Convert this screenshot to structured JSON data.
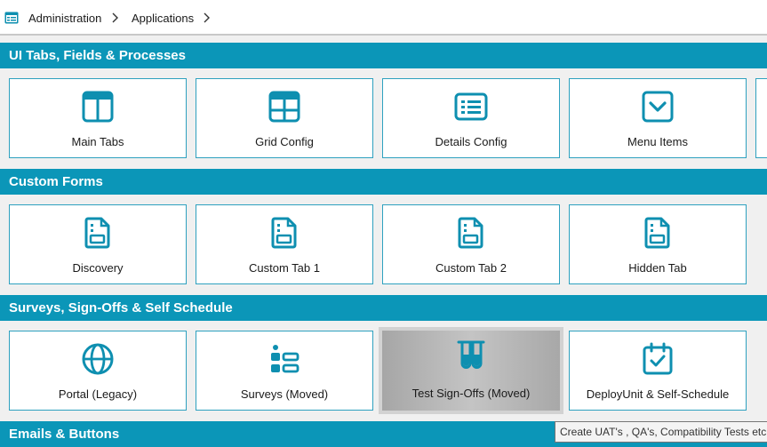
{
  "breadcrumb": {
    "items": [
      "Administration",
      "Applications"
    ]
  },
  "colors": {
    "accent": "#0b96b8",
    "icon": "#0e8fb0",
    "tile_border": "#2ea1bf"
  },
  "sections": [
    {
      "title": "UI Tabs, Fields & Processes",
      "tiles": [
        {
          "label": "Main Tabs",
          "icon": "columns-icon"
        },
        {
          "label": "Grid Config",
          "icon": "grid-icon"
        },
        {
          "label": "Details Config",
          "icon": "list-icon"
        },
        {
          "label": "Menu Items",
          "icon": "dropdown-icon"
        }
      ]
    },
    {
      "title": "Custom Forms",
      "tiles": [
        {
          "label": "Discovery",
          "icon": "form-document-icon"
        },
        {
          "label": "Custom Tab 1",
          "icon": "form-document-icon"
        },
        {
          "label": "Custom Tab 2",
          "icon": "form-document-icon"
        },
        {
          "label": "Hidden Tab",
          "icon": "form-document-icon"
        }
      ]
    },
    {
      "title": "Surveys, Sign-Offs & Self Schedule",
      "tiles": [
        {
          "label": "Portal (Legacy)",
          "icon": "globe-icon"
        },
        {
          "label": "Surveys (Moved)",
          "icon": "survey-list-icon"
        },
        {
          "label": "Test Sign-Offs (Moved)",
          "icon": "test-tubes-icon"
        },
        {
          "label": "DeployUnit & Self-Schedule",
          "icon": "calendar-check-icon"
        }
      ]
    },
    {
      "title": "Emails & Buttons",
      "tiles": []
    }
  ],
  "tooltip": "Create UAT's , QA's, Compatibility Tests etc. A"
}
